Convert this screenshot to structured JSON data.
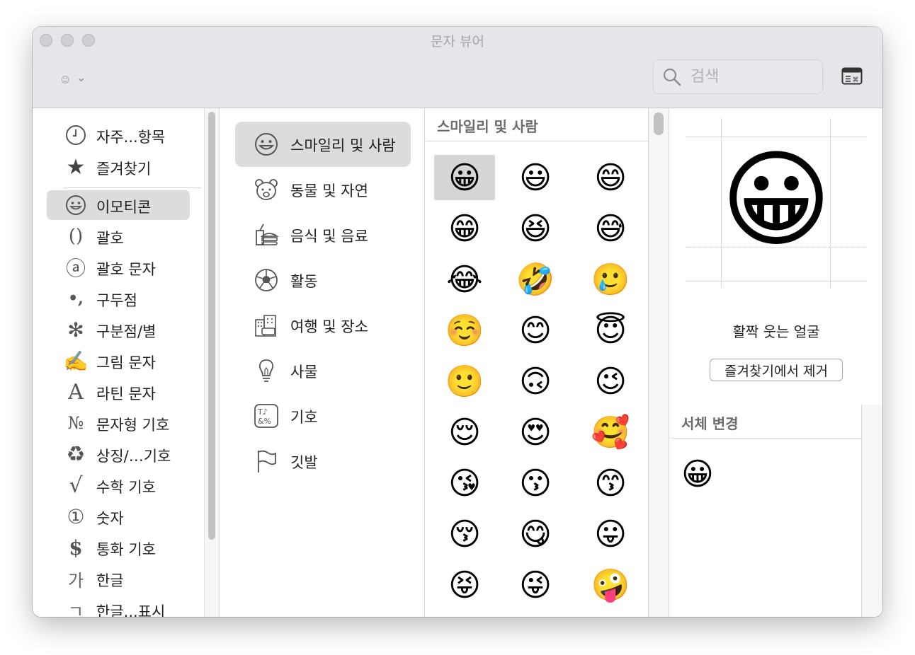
{
  "window": {
    "title": "문자 뷰어"
  },
  "toolbar": {
    "view_icon": "smiley-icon",
    "chevron_icon": "chevron-down-icon",
    "search_placeholder": "검색",
    "search_value": "",
    "keyboard_viewer_icon": "keyboard-viewer-icon"
  },
  "categories": [
    {
      "label": "자주...항목",
      "icon": "clock-icon",
      "glyph": ""
    },
    {
      "label": "즐겨찾기",
      "icon": "star-icon",
      "glyph": "★"
    },
    {
      "label": "이모티콘",
      "icon": "smiley-icon",
      "glyph": "☺",
      "selected": true
    },
    {
      "label": "괄호",
      "icon": "parentheses-icon",
      "glyph": "()"
    },
    {
      "label": "괄호 문자",
      "icon": "circled-a-icon",
      "glyph": "ⓐ"
    },
    {
      "label": "구두점",
      "icon": "punctuation-icon",
      "glyph": "•,"
    },
    {
      "label": "구분점/별",
      "icon": "asterisk-icon",
      "glyph": "✻"
    },
    {
      "label": "그림 문자",
      "icon": "writing-hand-icon",
      "glyph": "✍"
    },
    {
      "label": "라틴 문자",
      "icon": "latin-a-icon",
      "glyph": "A"
    },
    {
      "label": "문자형 기호",
      "icon": "numero-icon",
      "glyph": "№"
    },
    {
      "label": "상징/…기호",
      "icon": "recycle-icon",
      "glyph": "♻"
    },
    {
      "label": "수학 기호",
      "icon": "square-root-icon",
      "glyph": "√"
    },
    {
      "label": "숫자",
      "icon": "circled-one-icon",
      "glyph": "①"
    },
    {
      "label": "통화 기호",
      "icon": "dollar-icon",
      "glyph": "$"
    },
    {
      "label": "한글",
      "icon": "hangul-ga-icon",
      "glyph": "가"
    },
    {
      "label": "한글...표시",
      "icon": "hangul-giyeok-icon",
      "glyph": "ㄱ"
    }
  ],
  "subcategories": [
    {
      "label": "스마일리 및 사람",
      "icon": "smiley-icon",
      "selected": true
    },
    {
      "label": "동물 및 자연",
      "icon": "bear-icon"
    },
    {
      "label": "음식 및 음료",
      "icon": "food-icon"
    },
    {
      "label": "활동",
      "icon": "soccer-ball-icon"
    },
    {
      "label": "여행 및 장소",
      "icon": "building-icon"
    },
    {
      "label": "사물",
      "icon": "lightbulb-icon"
    },
    {
      "label": "기호",
      "icon": "symbols-icon"
    },
    {
      "label": "깃발",
      "icon": "flag-icon"
    }
  ],
  "emoji_panel": {
    "header": "스마일리 및 사람",
    "emojis": [
      "😀",
      "😃",
      "😄",
      "😁",
      "😆",
      "😅",
      "😂",
      "🤣",
      "🥲",
      "☺️",
      "😊",
      "😇",
      "🙂",
      "🙃",
      "😉",
      "😌",
      "😍",
      "🥰",
      "😘",
      "😗",
      "😙",
      "😚",
      "😋",
      "😛",
      "😝",
      "😜",
      "🤪"
    ],
    "selected_index": 0
  },
  "detail": {
    "preview_emoji": "😀",
    "char_name": "활짝 웃는 얼굴",
    "favorite_button": "즐겨찾기에서 제거",
    "variants_header": "서체 변경",
    "variants": [
      "😀"
    ]
  }
}
